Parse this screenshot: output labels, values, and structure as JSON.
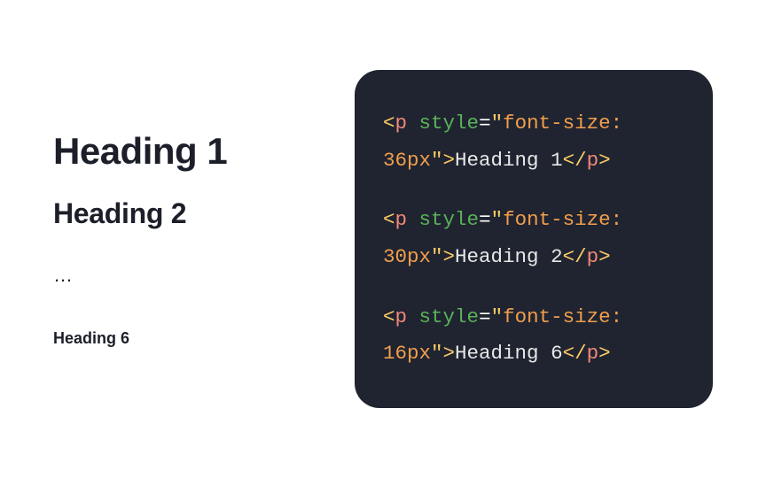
{
  "left": {
    "heading1": "Heading 1",
    "heading2": "Heading 2",
    "ellipsis": "…",
    "heading6": "Heading 6"
  },
  "code": {
    "lines": [
      {
        "open_bracket": "<",
        "tag": "p",
        "space": " ",
        "attr": "style",
        "eq": "=",
        "q1": "\"",
        "str": "font-size: 36px",
        "q2": "\"",
        "close_bracket": ">",
        "content": "Heading 1",
        "close_open": "</",
        "close_tag": "p",
        "close_close": ">"
      },
      {
        "open_bracket": "<",
        "tag": "p",
        "space": " ",
        "attr": "style",
        "eq": "=",
        "q1": "\"",
        "str": "font-size: 30px",
        "q2": "\"",
        "close_bracket": ">",
        "content": "Heading 2",
        "close_open": "</",
        "close_tag": "p",
        "close_close": ">"
      },
      {
        "open_bracket": "<",
        "tag": "p",
        "space": " ",
        "attr": "style",
        "eq": "=",
        "q1": "\"",
        "str": "font-size: 16px",
        "q2": "\"",
        "close_bracket": ">",
        "content": "Heading 6",
        "close_open": "</",
        "close_tag": "p",
        "close_close": ">"
      }
    ]
  }
}
